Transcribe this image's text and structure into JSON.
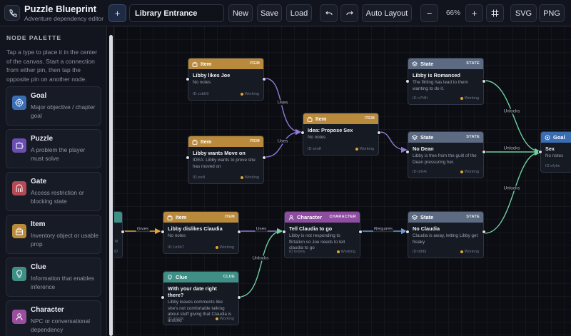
{
  "header": {
    "title": "Puzzle Blueprint",
    "subtitle": "Adventure dependency editor",
    "add_label": "+",
    "doc_title": "Library Entrance",
    "new_label": "New",
    "save_label": "Save",
    "load_label": "Load",
    "auto_layout_label": "Auto Layout",
    "zoom_out_label": "−",
    "zoom_level": "66%",
    "zoom_in_label": "+",
    "svg_label": "SVG",
    "png_label": "PNG"
  },
  "sidebar": {
    "title": "NODE PALETTE",
    "help": "Tap a type to place it in the center of the canvas. Start a connection from either pin, then tap the opposite pin on another node.",
    "items": [
      {
        "name": "Goal",
        "desc": "Major objective / chapter goal",
        "icon": "target-icon",
        "color": "#3b6db3"
      },
      {
        "name": "Puzzle",
        "desc": "A problem the player must solve",
        "icon": "puzzle-icon",
        "color": "#6a4fb0"
      },
      {
        "name": "Gate",
        "desc": "Access restriction or blocking state",
        "icon": "gate-icon",
        "color": "#b34a55"
      },
      {
        "name": "Item",
        "desc": "Inventory object or usable prop",
        "icon": "bag-icon",
        "color": "#b98a3c"
      },
      {
        "name": "Clue",
        "desc": "Information that enables inference",
        "icon": "lightbulb-icon",
        "color": "#3f8f86"
      },
      {
        "name": "Character",
        "desc": "NPC or conversational dependency",
        "icon": "person-icon",
        "color": "#9a4f9e"
      }
    ]
  },
  "colors": {
    "item": "#b98a3c",
    "state": "#5d6b82",
    "goal": "#3b6db3",
    "character": "#8e4da0",
    "clue": "#3f8f86",
    "edge_uses": "#8f7ad6",
    "edge_unlocks": "#6fcf9f",
    "edge_gives": "#e0a53c",
    "edge_requires": "#6b9bd8"
  },
  "canvas": {
    "nodes": {
      "libby_likes_joe": {
        "type": "Item",
        "tag": "ITEM",
        "title": "Libby likes Joe",
        "desc": "No notes",
        "id": "ID zxbfr9",
        "status": "Working"
      },
      "libby_wants_move": {
        "type": "Item",
        "tag": "ITEM",
        "title": "Libby wants Move on",
        "desc": "IDEA: Libby wants to prove she has moved on",
        "id": "ID jnoll",
        "status": "Working"
      },
      "idea_propose_sex": {
        "type": "Item",
        "tag": "ITEM",
        "title": "Idea: Propose Sex",
        "desc": "No notes",
        "id": "ID wmff",
        "status": "Working"
      },
      "libby_romanced": {
        "type": "State",
        "tag": "STATE",
        "title": "Libby is Romanced",
        "desc": "The flirting has lead to them wanting to do it.",
        "id": "ID o7f4fi",
        "status": "Working"
      },
      "no_dean": {
        "type": "State",
        "tag": "STATE",
        "title": "No Dean",
        "desc": "Libby is free from the guilt of the Dean pressuring her.",
        "id": "ID orb4i",
        "status": "Working"
      },
      "goal_sex": {
        "type": "Goal",
        "tag": "",
        "title": "Sex",
        "desc": "No notes",
        "id": "ID efylm",
        "status": ""
      },
      "partial_left": {
        "id": "ID",
        "desc": "ng"
      },
      "libby_dislikes_claudia": {
        "type": "Item",
        "tag": "ITEM",
        "title": "Libby dislikes Claudia",
        "desc": "No notes",
        "id": "ID 1n9bT",
        "status": "Working"
      },
      "tell_claudia": {
        "type": "Character",
        "tag": "CHARACTER",
        "title": "Tell Claudia to go",
        "desc": "Libby is not responding to flirtation so Joe needs to tell claudia to go",
        "id": "ID bobrw",
        "status": "Working"
      },
      "no_claudia": {
        "type": "State",
        "tag": "STATE",
        "title": "No Claudia",
        "desc": "Claudia is away, letting Libby get freaky",
        "id": "ID b8tbl",
        "status": "Working"
      },
      "clue_date": {
        "type": "Clue",
        "tag": "CLUE",
        "title": "With your date right there?",
        "desc": "Libby leaves comments like she's not comfortable talking about stuff giving that Claudia is around",
        "id": "ID qoqdx",
        "status": "Working"
      }
    },
    "edges": {
      "uses1": "Uses",
      "uses2": "Uses",
      "unlocks_romanced": "Unlocks",
      "unlocks_dean": "Unlocks",
      "unlocks_claudia": "Unlocks",
      "gives": "Gives",
      "uses3": "Uses",
      "requires": "Requires",
      "unlocks_clue": "Unlocks"
    }
  }
}
